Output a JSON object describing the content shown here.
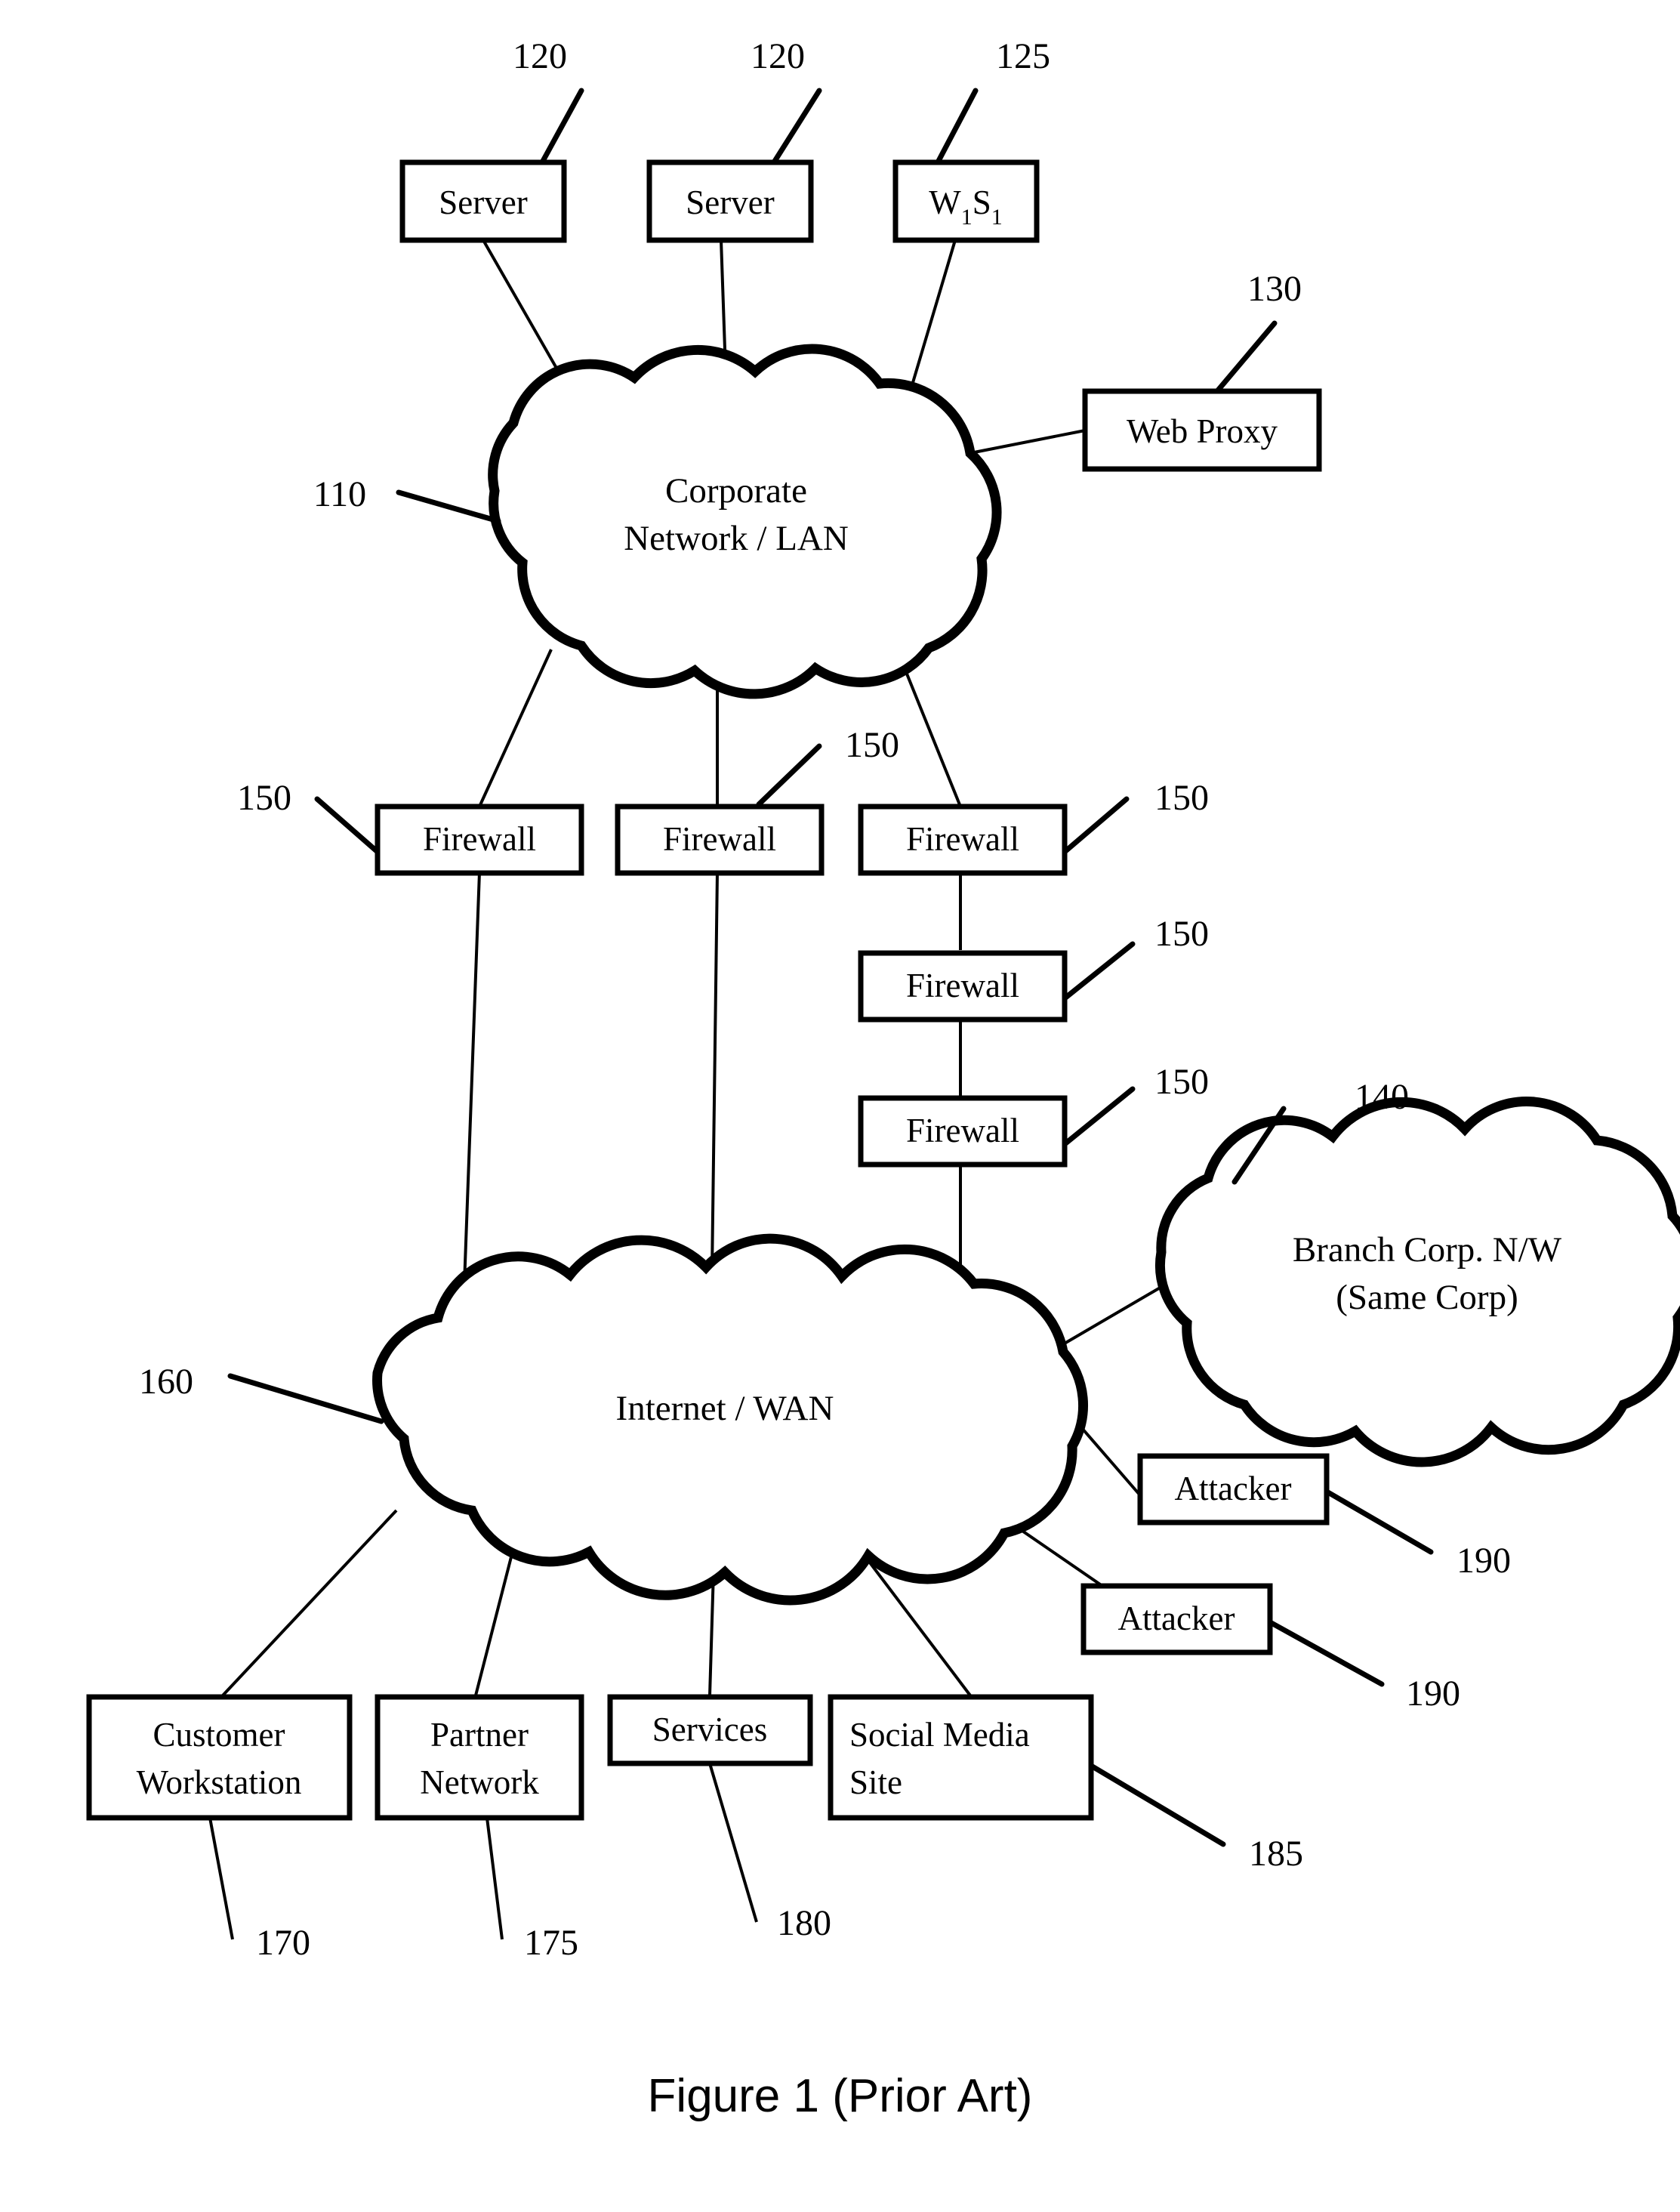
{
  "figure": {
    "caption": "Figure 1 (Prior Art)"
  },
  "nodes": {
    "server_1": {
      "label": "Server",
      "ref": "120"
    },
    "server_2": {
      "label": "Server",
      "ref": "120"
    },
    "w1s1": {
      "label_main": "W",
      "label_sub1": "1",
      "label_main2": "S",
      "label_sub2": "1",
      "ref": "125"
    },
    "web_proxy": {
      "label": "Web Proxy",
      "ref": "130"
    },
    "corporate_lan": {
      "line1": "Corporate",
      "line2": "Network / LAN",
      "ref": "110"
    },
    "firewall_1": {
      "label": "Firewall",
      "ref": "150"
    },
    "firewall_2": {
      "label": "Firewall",
      "ref": "150"
    },
    "firewall_3": {
      "label": "Firewall",
      "ref": "150"
    },
    "firewall_4": {
      "label": "Firewall",
      "ref": "150"
    },
    "firewall_5": {
      "label": "Firewall",
      "ref": "150"
    },
    "branch_corp": {
      "line1": "Branch Corp. N/W",
      "line2": "(Same Corp)",
      "ref": "140"
    },
    "internet_wan": {
      "label": "Internet / WAN",
      "ref": "160"
    },
    "attacker_1": {
      "label": "Attacker",
      "ref": "190"
    },
    "attacker_2": {
      "label": "Attacker",
      "ref": "190"
    },
    "customer_workstation": {
      "line1": "Customer",
      "line2": "Workstation",
      "ref": "170"
    },
    "partner_network": {
      "line1": "Partner",
      "line2": "Network",
      "ref": "175"
    },
    "services": {
      "label": "Services",
      "ref": "180"
    },
    "social_media": {
      "line1": "Social Media",
      "line2": "Site",
      "ref": "185"
    }
  },
  "colors": {
    "stroke": "#000000",
    "fill": "#ffffff"
  }
}
